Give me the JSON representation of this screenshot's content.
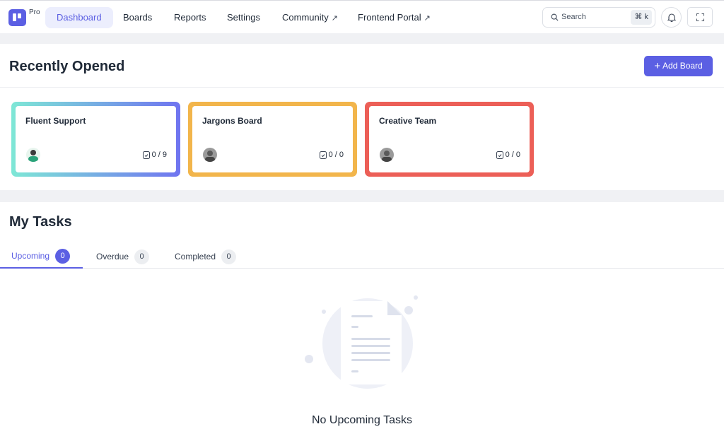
{
  "app": {
    "badge": "Pro"
  },
  "nav": {
    "items": [
      {
        "label": "Dashboard"
      },
      {
        "label": "Boards"
      },
      {
        "label": "Reports"
      },
      {
        "label": "Settings"
      },
      {
        "label": "Community",
        "external": "↗"
      },
      {
        "label": "Frontend Portal",
        "external": "↗"
      }
    ],
    "search": {
      "placeholder": "Search",
      "shortcut": "⌘ k"
    }
  },
  "recent": {
    "title": "Recently Opened",
    "add_button": "Add Board",
    "add_icon": "+",
    "boards": [
      {
        "name": "Fluent Support",
        "tasks": "0 / 9"
      },
      {
        "name": "Jargons Board",
        "tasks": "0 / 0"
      },
      {
        "name": "Creative Team",
        "tasks": "0 / 0"
      }
    ]
  },
  "tasks": {
    "title": "My Tasks",
    "tabs": [
      {
        "label": "Upcoming",
        "count": "0"
      },
      {
        "label": "Overdue",
        "count": "0"
      },
      {
        "label": "Completed",
        "count": "0"
      }
    ],
    "empty_message": "No Upcoming Tasks"
  },
  "colors": {
    "accent": "#5b5fe3",
    "board_gradient_start": "#7ee7d6",
    "board_gradient_end": "#6f74f0",
    "board_orange": "#f2b54b",
    "board_red": "#ec5f57"
  },
  "icons": [
    "logo-icon",
    "search-icon",
    "bell-icon",
    "fullscreen-icon",
    "plus-icon",
    "task-icon",
    "avatar",
    "empty-document-illustration"
  ]
}
